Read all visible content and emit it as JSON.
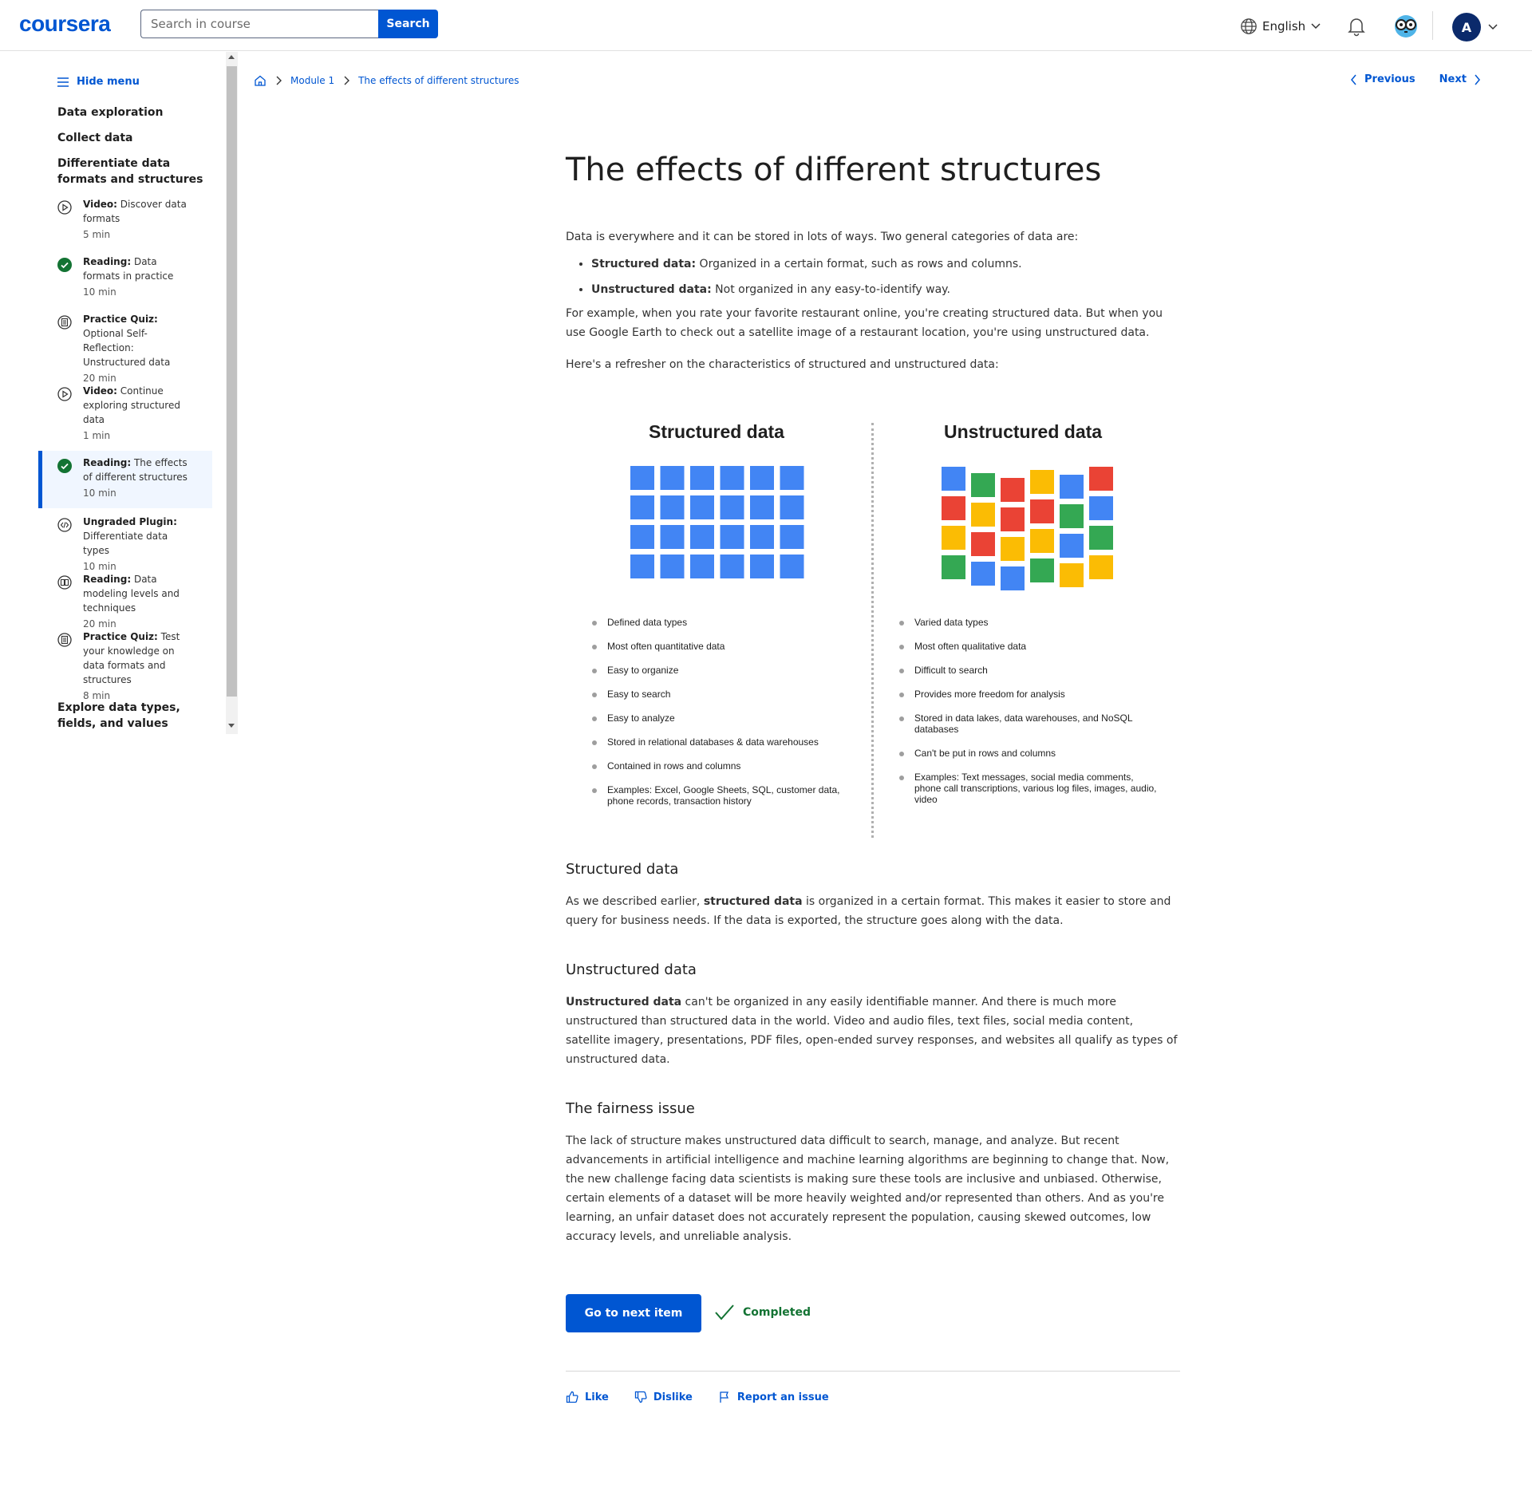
{
  "header": {
    "logo": "coursera",
    "search_placeholder": "Search in course",
    "search_button": "Search",
    "language": "English",
    "avatar_initial": "A"
  },
  "sidebar": {
    "hide_menu": "Hide menu",
    "sections": [
      "Data exploration",
      "Collect data",
      "Differentiate data formats and structures",
      "Explore data types, fields, and values"
    ],
    "items": [
      {
        "type": "Video:",
        "title": "Discover data formats",
        "duration": "5 min",
        "icon": "play-icon"
      },
      {
        "type": "Reading:",
        "title": "Data formats in practice",
        "duration": "10 min",
        "icon": "check-circle-icon"
      },
      {
        "type": "Practice Quiz:",
        "title": "Optional Self-Reflection: Unstructured data",
        "duration": "20 min",
        "icon": "quiz-icon"
      },
      {
        "type": "Video:",
        "title": "Continue exploring structured data",
        "duration": "1 min",
        "icon": "play-icon"
      },
      {
        "type": "Reading:",
        "title": "The effects of different structures",
        "duration": "10 min",
        "icon": "check-circle-icon"
      },
      {
        "type": "Ungraded Plugin:",
        "title": "Differentiate data types",
        "duration": "10 min",
        "icon": "plugin-icon"
      },
      {
        "type": "Reading:",
        "title": "Data modeling levels and techniques",
        "duration": "20 min",
        "icon": "book-icon"
      },
      {
        "type": "Practice Quiz:",
        "title": "Test your knowledge on data formats and structures",
        "duration": "8 min",
        "icon": "quiz-icon"
      }
    ]
  },
  "breadcrumb": {
    "module": "Module 1",
    "current": "The effects of different structures"
  },
  "nav": {
    "previous": "Previous",
    "next": "Next"
  },
  "content": {
    "title": "The effects of different structures",
    "intro": "Data is everywhere and it can be stored in lots of ways. Two general categories of data are:",
    "bullet1_label": "Structured data:",
    "bullet1_text": " Organized in a certain format, such as rows and columns.",
    "bullet2_label": "Unstructured data:",
    "bullet2_text": " Not organized in any easy-to-identify way.",
    "p_example": "For example, when you rate your favorite restaurant online, you're creating structured data. But when you use Google Earth to check out a satellite image of a restaurant location, you're using unstructured data.",
    "p_refresher": "Here's a refresher on the characteristics of structured and unstructured data:",
    "h_structured": "Structured data",
    "p_structured_pre": "As we described earlier, ",
    "p_structured_bold": "structured data",
    "p_structured_post": " is organized in a certain format. This makes it easier to store and query for business needs. If the data is exported, the structure goes along with the data.",
    "h_unstructured": "Unstructured data",
    "p_unstructured_bold": "Unstructured data",
    "p_unstructured_post": " can't be organized in any easily identifiable manner. And there is much more unstructured than structured data in the world. Video and audio files, text files, social media content, satellite imagery, presentations, PDF files, open-ended survey responses, and websites all qualify as types of unstructured data.",
    "h_fairness": "The fairness issue",
    "p_fairness": "The lack of structure makes unstructured data difficult to search, manage, and analyze. But recent advancements in artificial intelligence and machine learning algorithms are beginning to change that. Now, the new challenge facing data scientists is making sure these tools are inclusive and unbiased. Otherwise, certain elements of a dataset will be more heavily weighted and/or represented than others. And as you're learning, an unfair dataset does not accurately represent the population, causing skewed outcomes, low accuracy levels, and unreliable analysis."
  },
  "diagram": {
    "structured_title": "Structured data",
    "unstructured_title": "Unstructured data",
    "structured_points": [
      "Defined data types",
      "Most often quantitative data",
      "Easy to organize",
      "Easy to search",
      "Easy to analyze",
      "Stored in relational databases & data warehouses",
      "Contained in rows and columns",
      "Examples: Excel, Google Sheets, SQL, customer data, phone records, transaction history"
    ],
    "unstructured_points": [
      "Varied data types",
      "Most often qualitative data",
      "Difficult to search",
      "Provides more freedom for analysis",
      "Stored in data lakes, data warehouses, and NoSQL databases",
      "Can't be put in rows and columns",
      "Examples: Text messages, social media comments, phone call transcriptions, various log files, images, audio, video"
    ],
    "colors": {
      "blue": "#4285f4",
      "red": "#ea4335",
      "yellow": "#fbbc04",
      "green": "#34a853"
    }
  },
  "footer": {
    "next_button": "Go to next item",
    "completed": "Completed",
    "like": "Like",
    "dislike": "Dislike",
    "report": "Report an issue"
  }
}
